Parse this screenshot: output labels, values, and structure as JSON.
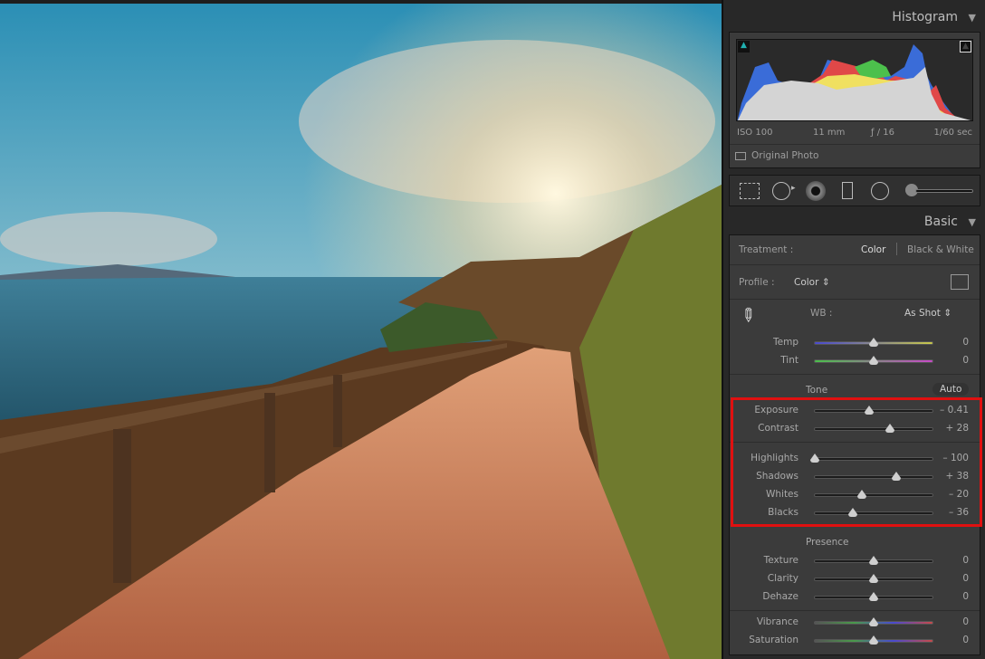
{
  "panel": {
    "histogram": {
      "title": "Histogram",
      "iso": "ISO 100",
      "focal": "11 mm",
      "aperture": "ƒ / 16",
      "shutter": "1/60 sec",
      "original_photo": "Original Photo"
    },
    "basic": {
      "title": "Basic",
      "treatment_label": "Treatment :",
      "treatment_color": "Color",
      "treatment_bw": "Black & White",
      "profile_label": "Profile :",
      "profile_value": "Color ⇕",
      "wb_label": "WB :",
      "wb_value": "As Shot ⇕",
      "tone_label": "Tone",
      "auto_label": "Auto",
      "presence_label": "Presence"
    },
    "sliders": [
      {
        "label": "Temp",
        "value": "0",
        "num": 0,
        "min": -100,
        "max": 100,
        "grad": "linear-gradient(90deg,#4a4ad0,#c8c84a)"
      },
      {
        "label": "Tint",
        "value": "0",
        "num": 0,
        "min": -100,
        "max": 100,
        "grad": "linear-gradient(90deg,#4ac04a,#c84ac8)"
      },
      {
        "label": "Exposure",
        "value": "– 0.41",
        "num": -0.41,
        "min": -5,
        "max": 5
      },
      {
        "label": "Contrast",
        "value": "+ 28",
        "num": 28,
        "min": -100,
        "max": 100
      },
      {
        "label": "Highlights",
        "value": "– 100",
        "num": -100,
        "min": -100,
        "max": 100
      },
      {
        "label": "Shadows",
        "value": "+ 38",
        "num": 38,
        "min": -100,
        "max": 100
      },
      {
        "label": "Whites",
        "value": "– 20",
        "num": -20,
        "min": -100,
        "max": 100
      },
      {
        "label": "Blacks",
        "value": "– 36",
        "num": -36,
        "min": -100,
        "max": 100
      },
      {
        "label": "Texture",
        "value": "0",
        "num": 0,
        "min": -100,
        "max": 100
      },
      {
        "label": "Clarity",
        "value": "0",
        "num": 0,
        "min": -100,
        "max": 100
      },
      {
        "label": "Dehaze",
        "value": "0",
        "num": 0,
        "min": -100,
        "max": 100
      },
      {
        "label": "Vibrance",
        "value": "0",
        "num": 0,
        "min": -100,
        "max": 100,
        "grad": "linear-gradient(90deg,#555,#4a9a4a,#4a4ad0,#c84a4a)"
      },
      {
        "label": "Saturation",
        "value": "0",
        "num": 0,
        "min": -100,
        "max": 100,
        "grad": "linear-gradient(90deg,#555,#4a9a4a,#4a4ad0,#c84a4a)"
      }
    ],
    "highlight_color": "#e01010"
  }
}
